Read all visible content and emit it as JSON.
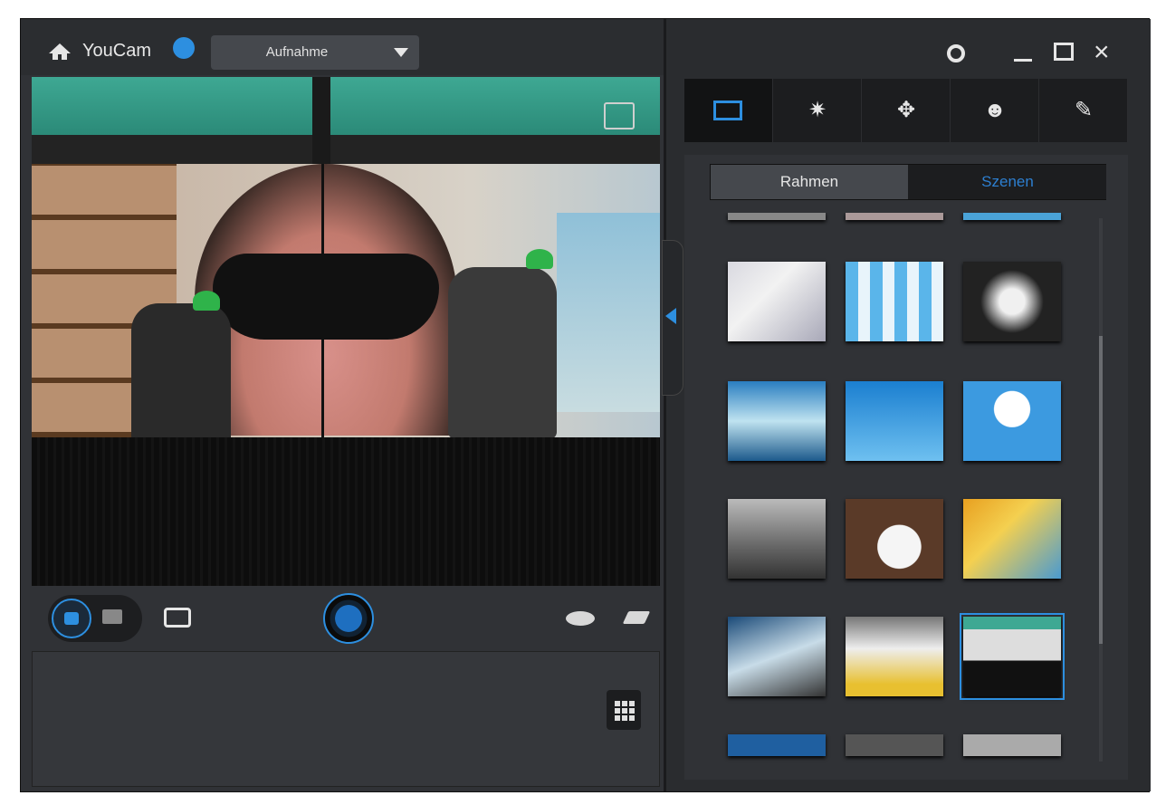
{
  "app": {
    "name": "YouCam"
  },
  "header": {
    "mode_dropdown": "Aufnahme"
  },
  "effects_panel": {
    "tabs": [
      {
        "name": "frames",
        "icon": "frame-icon",
        "active": true
      },
      {
        "name": "particles",
        "icon": "magic-wand-icon",
        "active": false
      },
      {
        "name": "distortion",
        "icon": "distortion-icon",
        "active": false
      },
      {
        "name": "avatar",
        "icon": "avatar-icon",
        "active": false
      },
      {
        "name": "draw",
        "icon": "pen-icon",
        "active": false
      }
    ],
    "segment": {
      "rahmen": "Rahmen",
      "szenen": "Szenen",
      "selected": "Szenen"
    }
  },
  "colors": {
    "accent": "#2d8fe0",
    "panel": "#303236",
    "background": "#2a2c2f"
  },
  "icons": [
    "home-icon",
    "notification-bell-icon",
    "gear-icon",
    "minimize-icon",
    "maximize-icon",
    "close-icon",
    "frame-toggle-icon",
    "photo-icon",
    "video-icon",
    "add-photo-icon",
    "shutter-icon",
    "eye-icon",
    "eraser-icon",
    "grid-icon",
    "collapse-arrow-icon"
  ]
}
